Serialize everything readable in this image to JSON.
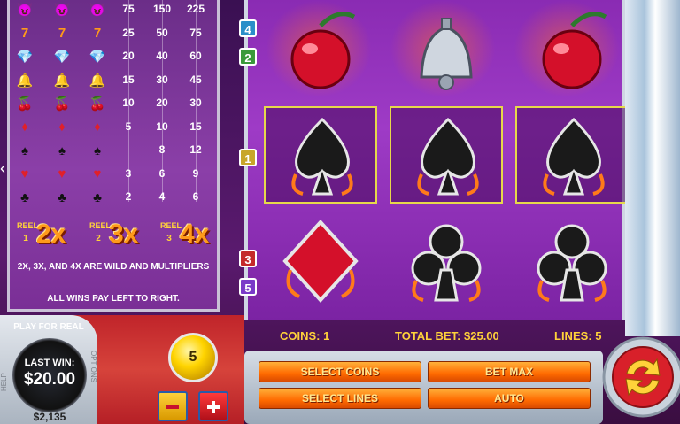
{
  "paytable": {
    "rows": [
      {
        "symbol": "devil-face-icon",
        "glyph": "😈",
        "values": [
          "75",
          "150",
          "225"
        ]
      },
      {
        "symbol": "seven-icon",
        "glyph": "7",
        "values": [
          "25",
          "50",
          "75"
        ]
      },
      {
        "symbol": "diamond-gem-icon",
        "glyph": "💎",
        "values": [
          "20",
          "40",
          "60"
        ]
      },
      {
        "symbol": "bell-icon",
        "glyph": "🔔",
        "values": [
          "15",
          "30",
          "45"
        ]
      },
      {
        "symbol": "cherry-icon",
        "glyph": "🍒",
        "values": [
          "10",
          "20",
          "30"
        ]
      },
      {
        "symbol": "diamond-suit-icon",
        "glyph": "♦",
        "values": [
          "5",
          "10",
          "15"
        ]
      },
      {
        "symbol": "spade-icon",
        "glyph": "♠",
        "values": [
          "",
          "8",
          "12"
        ]
      },
      {
        "symbol": "heart-icon",
        "glyph": "♥",
        "values": [
          "3",
          "6",
          "9"
        ]
      },
      {
        "symbol": "club-icon",
        "glyph": "♣",
        "values": [
          "2",
          "4",
          "6"
        ]
      }
    ],
    "reels": [
      {
        "word": "REEL",
        "num": "1",
        "mult": "2x"
      },
      {
        "word": "REEL",
        "num": "2",
        "mult": "3x"
      },
      {
        "word": "REEL",
        "num": "3",
        "mult": "4x"
      }
    ],
    "note_wild": "2X, 3X, AND 4X ARE WILD AND MULTIPLIERS",
    "note_pays": "ALL WINS PAY LEFT TO RIGHT."
  },
  "paylines": {
    "m1": "1",
    "m2": "2",
    "m3": "3",
    "m4": "4",
    "m5": "5"
  },
  "reels_grid": [
    [
      "cherry-icon",
      "bell-icon",
      "cherry-icon"
    ],
    [
      "spade-icon",
      "spade-icon",
      "spade-icon"
    ],
    [
      "diamond-suit-icon",
      "club-icon",
      "club-icon"
    ]
  ],
  "info": {
    "coins": "COINS: 1",
    "total_bet": "TOTAL BET: $25.00",
    "lines": "LINES: 5"
  },
  "controls": {
    "select_coins": "SELECT COINS",
    "bet_max": "BET MAX",
    "select_lines": "SELECT LINES",
    "auto": "AUTO"
  },
  "console": {
    "play_for_real": "PLAY FOR REAL",
    "last_win_label": "LAST WIN:",
    "last_win_value": "$20.00",
    "balance": "$2,135",
    "coin_value": "5",
    "help": "HELP",
    "options": "OPTIONS"
  },
  "colors": {
    "accent": "#ffd23a",
    "frame": "#8a2bb3",
    "button": "#ff6a00"
  }
}
